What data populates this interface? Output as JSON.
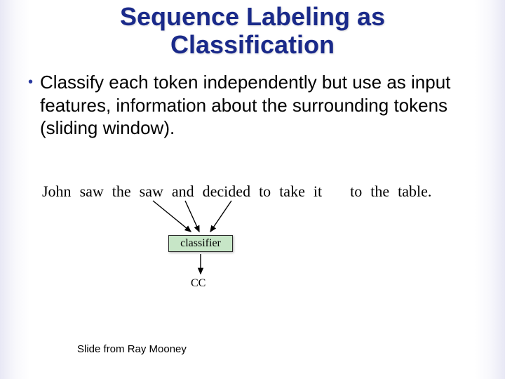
{
  "title_line1": "Sequence Labeling as",
  "title_line2": "Classification",
  "bullet1": "Classify each token independently but use as input features, information about the surrounding tokens (sliding window).",
  "tokens": {
    "t0": "John",
    "t1": "saw",
    "t2": "the",
    "t3": "saw",
    "t4": "and",
    "t5": "decided",
    "t6": "to",
    "t7": "take",
    "t8": "it",
    "t9": "to",
    "t10": "the",
    "t11": "table."
  },
  "classifier_label": "classifier",
  "output_tag": "CC",
  "footer": "Slide from Ray Mooney"
}
